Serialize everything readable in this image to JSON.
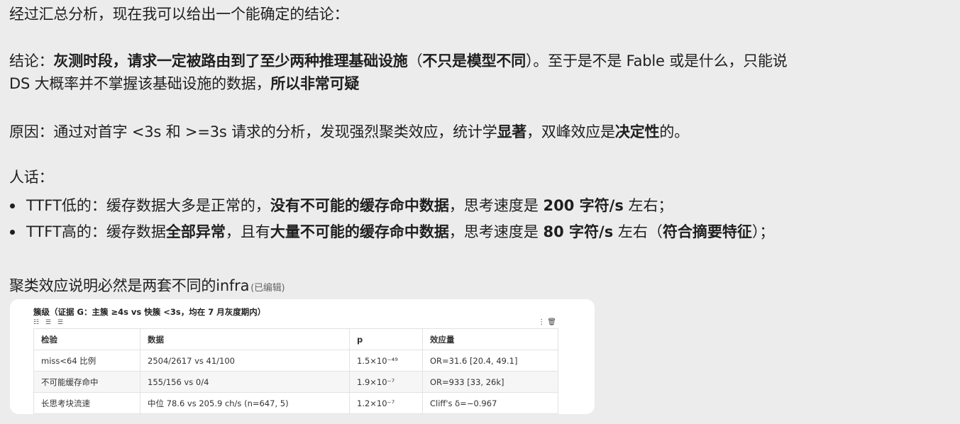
{
  "message": {
    "p1": "经过汇总分析，现在我可以给出一个能确定的结论：",
    "p2": {
      "a": "结论：",
      "b": "灰测时段，请求一定被路由到了至少两种推理基础设施",
      "c": "（",
      "d": "不只是模型不同",
      "e": "）。",
      "f": "至于是不是 Fable 或是什么，只能说",
      "g": "DS 大概率并不掌握该基础设施的数据，",
      "h": "所以非常可疑"
    },
    "p3": {
      "a": "原因：通过对首字 <3s 和 >=3s 请求的分析，发现强烈聚类效应，统计学",
      "b": "显著",
      "c": "，双峰效应是",
      "d": "决定性",
      "e": "的。"
    },
    "p4": "人话：",
    "bullet1": {
      "a": "TTFT低的：缓存数据大多是正常的，",
      "b": "没有不可能的缓存命中数据",
      "c": "，思考速度是 ",
      "d": "200 字符/s",
      "e": " 左右；"
    },
    "bullet2": {
      "a": "TTFT高的：缓存数据",
      "b": "全部异常",
      "c": "，且有",
      "d": "大量不可能的缓存命中数据",
      "e": "，思考速度是 ",
      "f": "80 字符/s",
      "g": " 左右（",
      "h": "符合摘要特征",
      "i": "）；"
    },
    "p5": "聚类效应说明必然是两套不同的infra",
    "edited": "(已编辑)"
  },
  "card": {
    "title": "簇级（证据 G：主簇 ≥4s vs 快簇 <3s，均在 7 月灰度期内）",
    "tools": "☷ ☰ ☰",
    "icons": "⋮ 🗑",
    "headers": [
      "检验",
      "数据",
      "p",
      "效应量"
    ],
    "rows": [
      [
        "miss<64 比例",
        "2504/2617 vs 41/100",
        "1.5×10⁻⁴⁹",
        "OR=31.6 [20.4, 49.1]"
      ],
      [
        "不可能缓存命中",
        "155/156 vs 0/4",
        "1.9×10⁻⁷",
        "OR=933 [33, 26k]"
      ],
      [
        "长思考块流速",
        "中位 78.6 vs 205.9 ch/s (n=647, 5)",
        "1.2×10⁻⁷",
        "Cliff's δ=−0.967"
      ]
    ]
  }
}
